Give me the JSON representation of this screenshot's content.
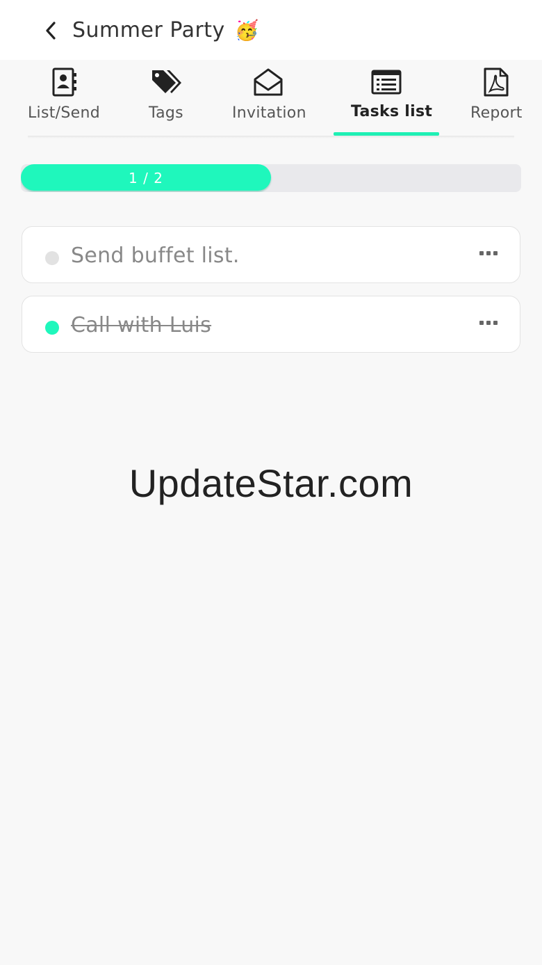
{
  "header": {
    "title": "Summer Party",
    "title_emoji": "🥳"
  },
  "tabs": [
    {
      "label": "List/Send",
      "icon": "contacts-book-icon",
      "active": false
    },
    {
      "label": "Tags",
      "icon": "tags-icon",
      "active": false
    },
    {
      "label": "Invitation",
      "icon": "envelope-open-icon",
      "active": false
    },
    {
      "label": "Tasks list",
      "icon": "task-list-icon",
      "active": true
    },
    {
      "label": "Report",
      "icon": "pdf-report-icon",
      "active": false
    }
  ],
  "progress": {
    "done": 1,
    "total": 2,
    "text": "1 / 2"
  },
  "tasks": [
    {
      "text": "Send buffet list.",
      "done": false,
      "status_color": "#e2e2e2"
    },
    {
      "text": "Call with Luis",
      "done": true,
      "status_color": "#1ff7bc"
    }
  ],
  "watermark": "UpdateStar.com",
  "colors": {
    "accent": "#1ff7bc",
    "tab_underline": "#1ff0b4",
    "track": "#e9e9ec"
  }
}
